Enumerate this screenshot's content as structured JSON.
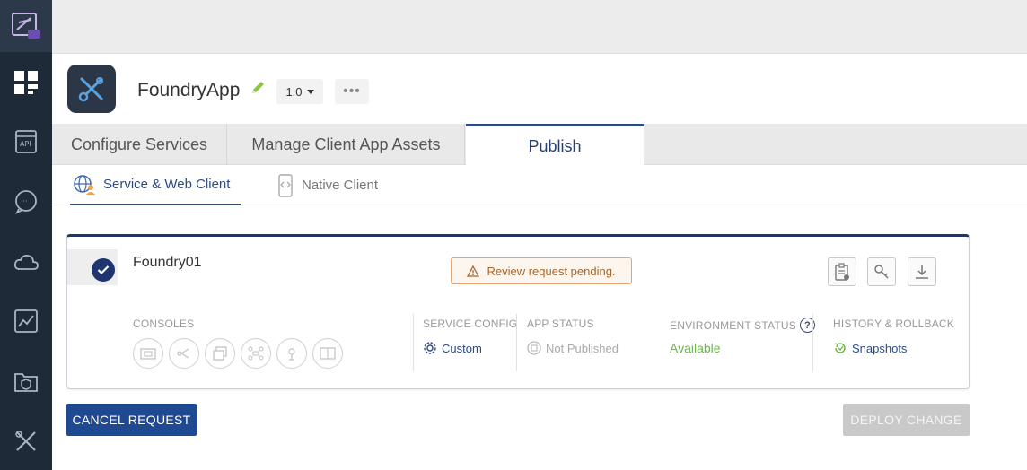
{
  "app": {
    "name": "FoundryApp",
    "version": "1.0",
    "more_label": "•••"
  },
  "tabs": [
    {
      "label": "Configure Services"
    },
    {
      "label": "Manage Client App Assets"
    },
    {
      "label": "Publish"
    }
  ],
  "subtabs": [
    {
      "label": "Service & Web Client"
    },
    {
      "label": "Native Client"
    }
  ],
  "environment": {
    "name": "Foundry01",
    "pending_message": "Review request pending.",
    "columns": {
      "consoles_label": "CONSOLES",
      "service_config_label": "SERVICE CONFIG",
      "service_config_value": "Custom",
      "app_status_label": "APP STATUS",
      "app_status_value": "Not Published",
      "env_status_label": "ENVIRONMENT STATUS",
      "env_status_value": "Available",
      "history_label": "HISTORY & ROLLBACK",
      "history_value": "Snapshots"
    },
    "help_glyph": "?"
  },
  "buttons": {
    "cancel": "CANCEL REQUEST",
    "deploy": "DEPLOY CHANGE"
  },
  "colors": {
    "rail": "#1e2a38",
    "accent": "#1f3570",
    "available": "#6bb34a",
    "pending_text": "#a8652b",
    "pending_border": "#e3a574"
  }
}
